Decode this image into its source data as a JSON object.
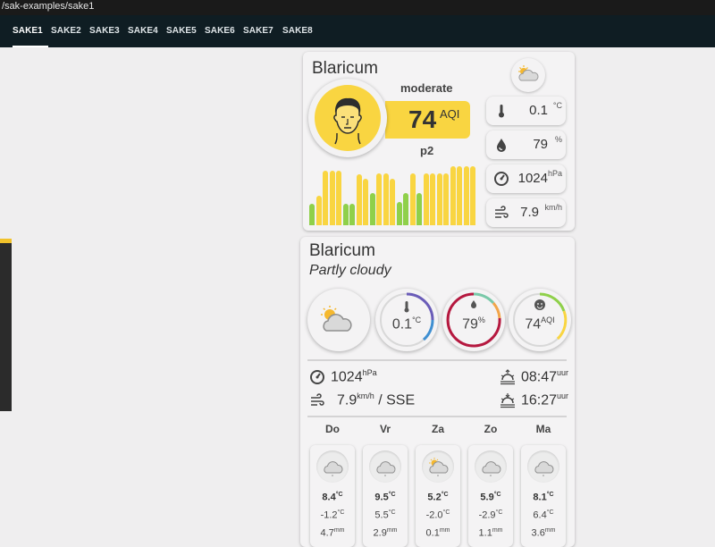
{
  "browser": {
    "url": "/sak-examples/sake1"
  },
  "tabs": [
    "SAKE1",
    "SAKE2",
    "SAKE3",
    "SAKE4",
    "SAKE5",
    "SAKE6",
    "SAKE7",
    "SAKE8"
  ],
  "active_tab": "SAKE1",
  "colors": {
    "accent": "#f9d541",
    "green": "#8fd04a",
    "dark_nav": "#0f1d23"
  },
  "card1": {
    "title": "Blaricum",
    "aqi_level": "moderate",
    "aqi_value": "74",
    "aqi_unit": "AQI",
    "pollutant": "p2",
    "history": {
      "levels": [
        0.25,
        0.35,
        0.65,
        0.65,
        0.65,
        0.25,
        0.25,
        0.6,
        0.55,
        0.38,
        0.62,
        0.62,
        0.55,
        0.28,
        0.38,
        0.62,
        0.38,
        0.62,
        0.62,
        0.62,
        0.62,
        0.7,
        0.7,
        0.7,
        0.7
      ],
      "colors": [
        "g",
        "y",
        "y",
        "y",
        "y",
        "g",
        "g",
        "y",
        "y",
        "g",
        "y",
        "y",
        "y",
        "g",
        "g",
        "y",
        "g",
        "y",
        "y",
        "y",
        "y",
        "y",
        "y",
        "y",
        "y"
      ]
    },
    "sensors": [
      {
        "icon": "thermometer-icon",
        "value": "0.1",
        "unit": "°C"
      },
      {
        "icon": "humidity-drop-icon",
        "value": "79",
        "unit": "%"
      },
      {
        "icon": "barometer-icon",
        "value": "1024",
        "unit": "hPa"
      },
      {
        "icon": "wind-icon",
        "value": "7.9",
        "unit": "km/h"
      }
    ]
  },
  "card2": {
    "title": "Blaricum",
    "condition": "Partly cloudy",
    "temp": {
      "value": "0.1",
      "unit": "°C"
    },
    "humidity": {
      "value": "79",
      "unit": "%"
    },
    "aqi": {
      "value": "74",
      "unit": "AQI"
    },
    "pressure": {
      "value": "1024",
      "unit": "hPa"
    },
    "wind": {
      "value": "7.9",
      "unit": "km/h",
      "direction": "/ SSE"
    },
    "sunrise": {
      "value": "08:47",
      "unit": "uur"
    },
    "sunset": {
      "value": "16:27",
      "unit": "uur"
    },
    "forecast": [
      {
        "day": "Do",
        "icon": "cloud-icon",
        "high": "8.4",
        "low": "-1.2",
        "rain": "4.7",
        "temp_unit": "°C",
        "rain_unit": "mm"
      },
      {
        "day": "Vr",
        "icon": "cloud-icon",
        "high": "9.5",
        "low": "5.5",
        "rain": "2.9",
        "temp_unit": "°C",
        "rain_unit": "mm"
      },
      {
        "day": "Za",
        "icon": "partly-cloudy-icon",
        "high": "5.2",
        "low": "-2.0",
        "rain": "0.1",
        "temp_unit": "°C",
        "rain_unit": "mm"
      },
      {
        "day": "Zo",
        "icon": "cloud-icon",
        "high": "5.9",
        "low": "-2.9",
        "rain": "1.1",
        "temp_unit": "°C",
        "rain_unit": "mm"
      },
      {
        "day": "Ma",
        "icon": "cloud-icon",
        "high": "8.1",
        "low": "6.4",
        "rain": "3.6",
        "temp_unit": "°C",
        "rain_unit": "mm"
      }
    ]
  }
}
